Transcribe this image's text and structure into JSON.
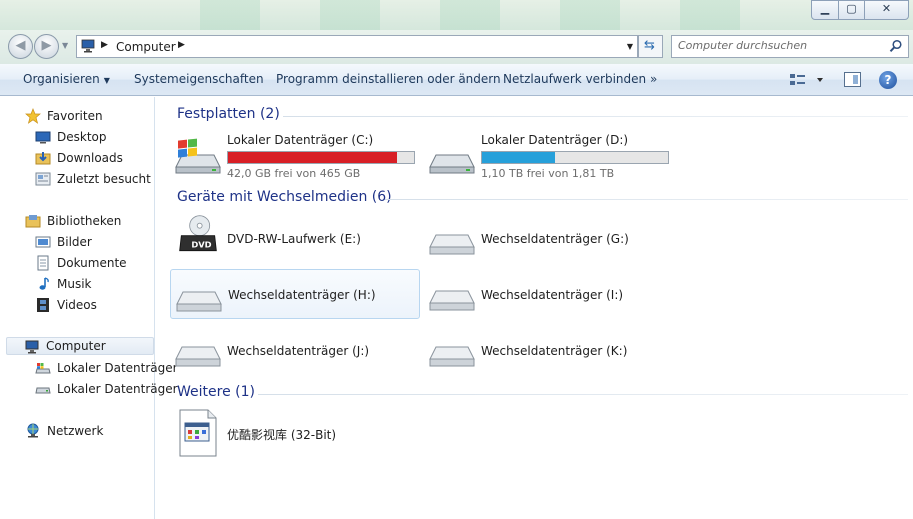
{
  "address": {
    "location": "Computer"
  },
  "search": {
    "placeholder": "Computer durchsuchen"
  },
  "toolbar": {
    "organize": "Organisieren",
    "system_properties": "Systemeigenschaften",
    "uninstall": "Programm deinstallieren oder ändern",
    "map_drive": "Netzlaufwerk verbinden",
    "more": "»",
    "help": "?"
  },
  "sidebar": {
    "favorites": "Favoriten",
    "desktop": "Desktop",
    "downloads": "Downloads",
    "recent": "Zuletzt besucht",
    "libraries": "Bibliotheken",
    "pictures": "Bilder",
    "documents": "Dokumente",
    "music": "Musik",
    "videos": "Videos",
    "computer": "Computer",
    "local_c": "Lokaler Datenträger",
    "local_d": "Lokaler Datenträger",
    "network": "Netzwerk"
  },
  "groups": {
    "hard_disks": "Festplatten (2)",
    "removable": "Geräte mit Wechselmedien (6)",
    "other": "Weitere (1)"
  },
  "drives": {
    "c": {
      "name": "Lokaler Datenträger (C:)",
      "free": "42,0 GB frei von 465 GB",
      "used_fraction": 0.91,
      "bar_color": "#d81f26"
    },
    "d": {
      "name": "Lokaler Datenträger (D:)",
      "free": "1,10 TB frei von 1,81 TB",
      "used_fraction": 0.39,
      "bar_color": "#26a0da"
    },
    "e": {
      "name": "DVD-RW-Laufwerk (E:)",
      "icon_label": "DVD"
    },
    "g": {
      "name": "Wechseldatenträger (G:)"
    },
    "h": {
      "name": "Wechseldatenträger (H:)"
    },
    "i": {
      "name": "Wechseldatenträger (I:)"
    },
    "j": {
      "name": "Wechseldatenträger (J:)"
    },
    "k": {
      "name": "Wechseldatenträger (K:)"
    }
  },
  "other_items": {
    "youku": {
      "name": "优酷影视库 (32-Bit)"
    }
  }
}
